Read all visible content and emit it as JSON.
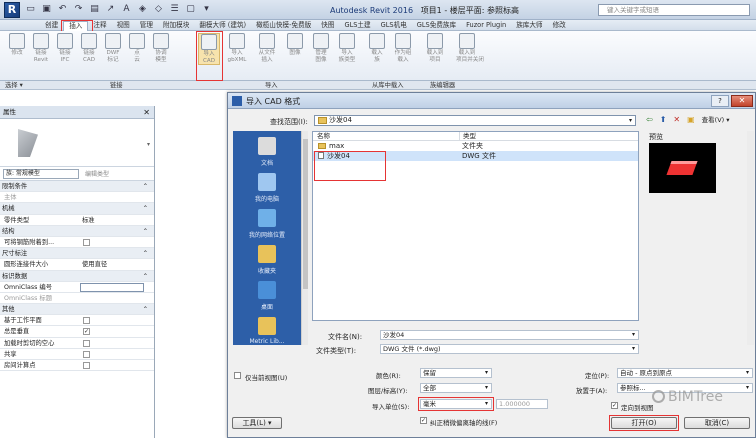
{
  "app": {
    "logo": "R",
    "title_app": "Autodesk Revit 2016",
    "title_doc": "项目1 - 楼层平面: 参照标高",
    "search_placeholder": "键入关键字或短语"
  },
  "tabs": [
    "创建",
    "插入",
    "注释",
    "视图",
    "管理",
    "附加模块",
    "翻模大师 (建筑)",
    "橄榄山快模-免费版",
    "快图",
    "GLS土建",
    "GLS机电",
    "GLS免费族库",
    "Fuzor Plugin",
    "族库大师",
    "修改"
  ],
  "ribbon": {
    "buttons": [
      {
        "label": "修改"
      },
      {
        "label": "链接\nRevit"
      },
      {
        "label": "链接\nIFC"
      },
      {
        "label": "链接\nCAD"
      },
      {
        "label": "DWF\n标记"
      },
      {
        "label": "点\n云"
      },
      {
        "label": "协调\n模型"
      },
      {
        "label": "导入\nCAD"
      },
      {
        "label": "导入\ngbXML"
      },
      {
        "label": "从文件\n插入"
      },
      {
        "label": "图像"
      },
      {
        "label": "管理\n图像"
      },
      {
        "label": "导入\n族类型"
      },
      {
        "label": "载入\n族"
      },
      {
        "label": "作为组\n载入"
      },
      {
        "label": "载入到\n项目"
      },
      {
        "label": "载入到\n项目并关闭"
      }
    ],
    "groups": [
      "选择 ▾",
      "链接",
      "导入",
      "从库中载入",
      "族编辑器"
    ]
  },
  "properties": {
    "title": "属性",
    "close": "✕",
    "family": "族: 常规模型",
    "edit_type": "编辑类型",
    "rows": [
      {
        "kind": "hdr",
        "k": "限制条件"
      },
      {
        "kind": "dim",
        "k": "主体"
      },
      {
        "kind": "hdr",
        "k": "机械"
      },
      {
        "kind": "val",
        "k": "零件类型",
        "v": "标准"
      },
      {
        "kind": "hdr",
        "k": "结构"
      },
      {
        "kind": "cb",
        "k": "可将钢筋附着到...",
        "checked": false
      },
      {
        "kind": "hdr",
        "k": "尺寸标注"
      },
      {
        "kind": "val",
        "k": "圆形连接件大小",
        "v": "使用直径"
      },
      {
        "kind": "hdr",
        "k": "标识数据"
      },
      {
        "kind": "box",
        "k": "OmniClass 编号"
      },
      {
        "kind": "dim",
        "k": "OmniClass 标题"
      },
      {
        "kind": "hdr",
        "k": "其他"
      },
      {
        "kind": "cb",
        "k": "基于工作平面",
        "checked": false
      },
      {
        "kind": "cb",
        "k": "总是垂直",
        "checked": true
      },
      {
        "kind": "cb",
        "k": "加载时剪切的空心",
        "checked": false
      },
      {
        "kind": "cb",
        "k": "共享",
        "checked": false
      },
      {
        "kind": "cb",
        "k": "房间计算点",
        "checked": false
      }
    ]
  },
  "dialog": {
    "title": "导入 CAD 格式",
    "help": "?",
    "close": "✕",
    "lookin_label": "查找范围(I):",
    "lookin_value": "沙发04",
    "views_label": "查看(V) ▾",
    "places": [
      "文档",
      "我的电脑",
      "我的网络位置",
      "收藏夹",
      "桌面",
      "Metric Lib..."
    ],
    "columns": {
      "name": "名称",
      "type": "类型"
    },
    "files": [
      {
        "name": "max",
        "type": "文件夹",
        "icon": "folder"
      },
      {
        "name": "沙发04",
        "type": "DWG 文件",
        "icon": "dwg"
      }
    ],
    "preview_label": "预览",
    "filename_label": "文件名(N):",
    "filename_value": "沙发04",
    "filetype_label": "文件类型(T):",
    "filetype_value": "DWG 文件 (*.dwg)",
    "current_view_only": "仅当前视图(U)",
    "colors_label": "颜色(R):",
    "colors_value": "保留",
    "layers_label": "图层/标高(Y):",
    "layers_value": "全部",
    "units_label": "导入单位(S):",
    "units_value": "毫米",
    "units_factor": "1.000000",
    "correct_lines": "纠正稍微偏离轴的线(F)",
    "positioning_label": "定位(P):",
    "positioning_value": "自动 - 原点到原点",
    "placeat_label": "放置于(A):",
    "placeat_value": "参照标...",
    "orient_view": "定向到视图",
    "tools_btn": "工具(L) ▾",
    "open_btn": "打开(O)",
    "cancel_btn": "取消(C)"
  },
  "watermark": "BIMTree"
}
